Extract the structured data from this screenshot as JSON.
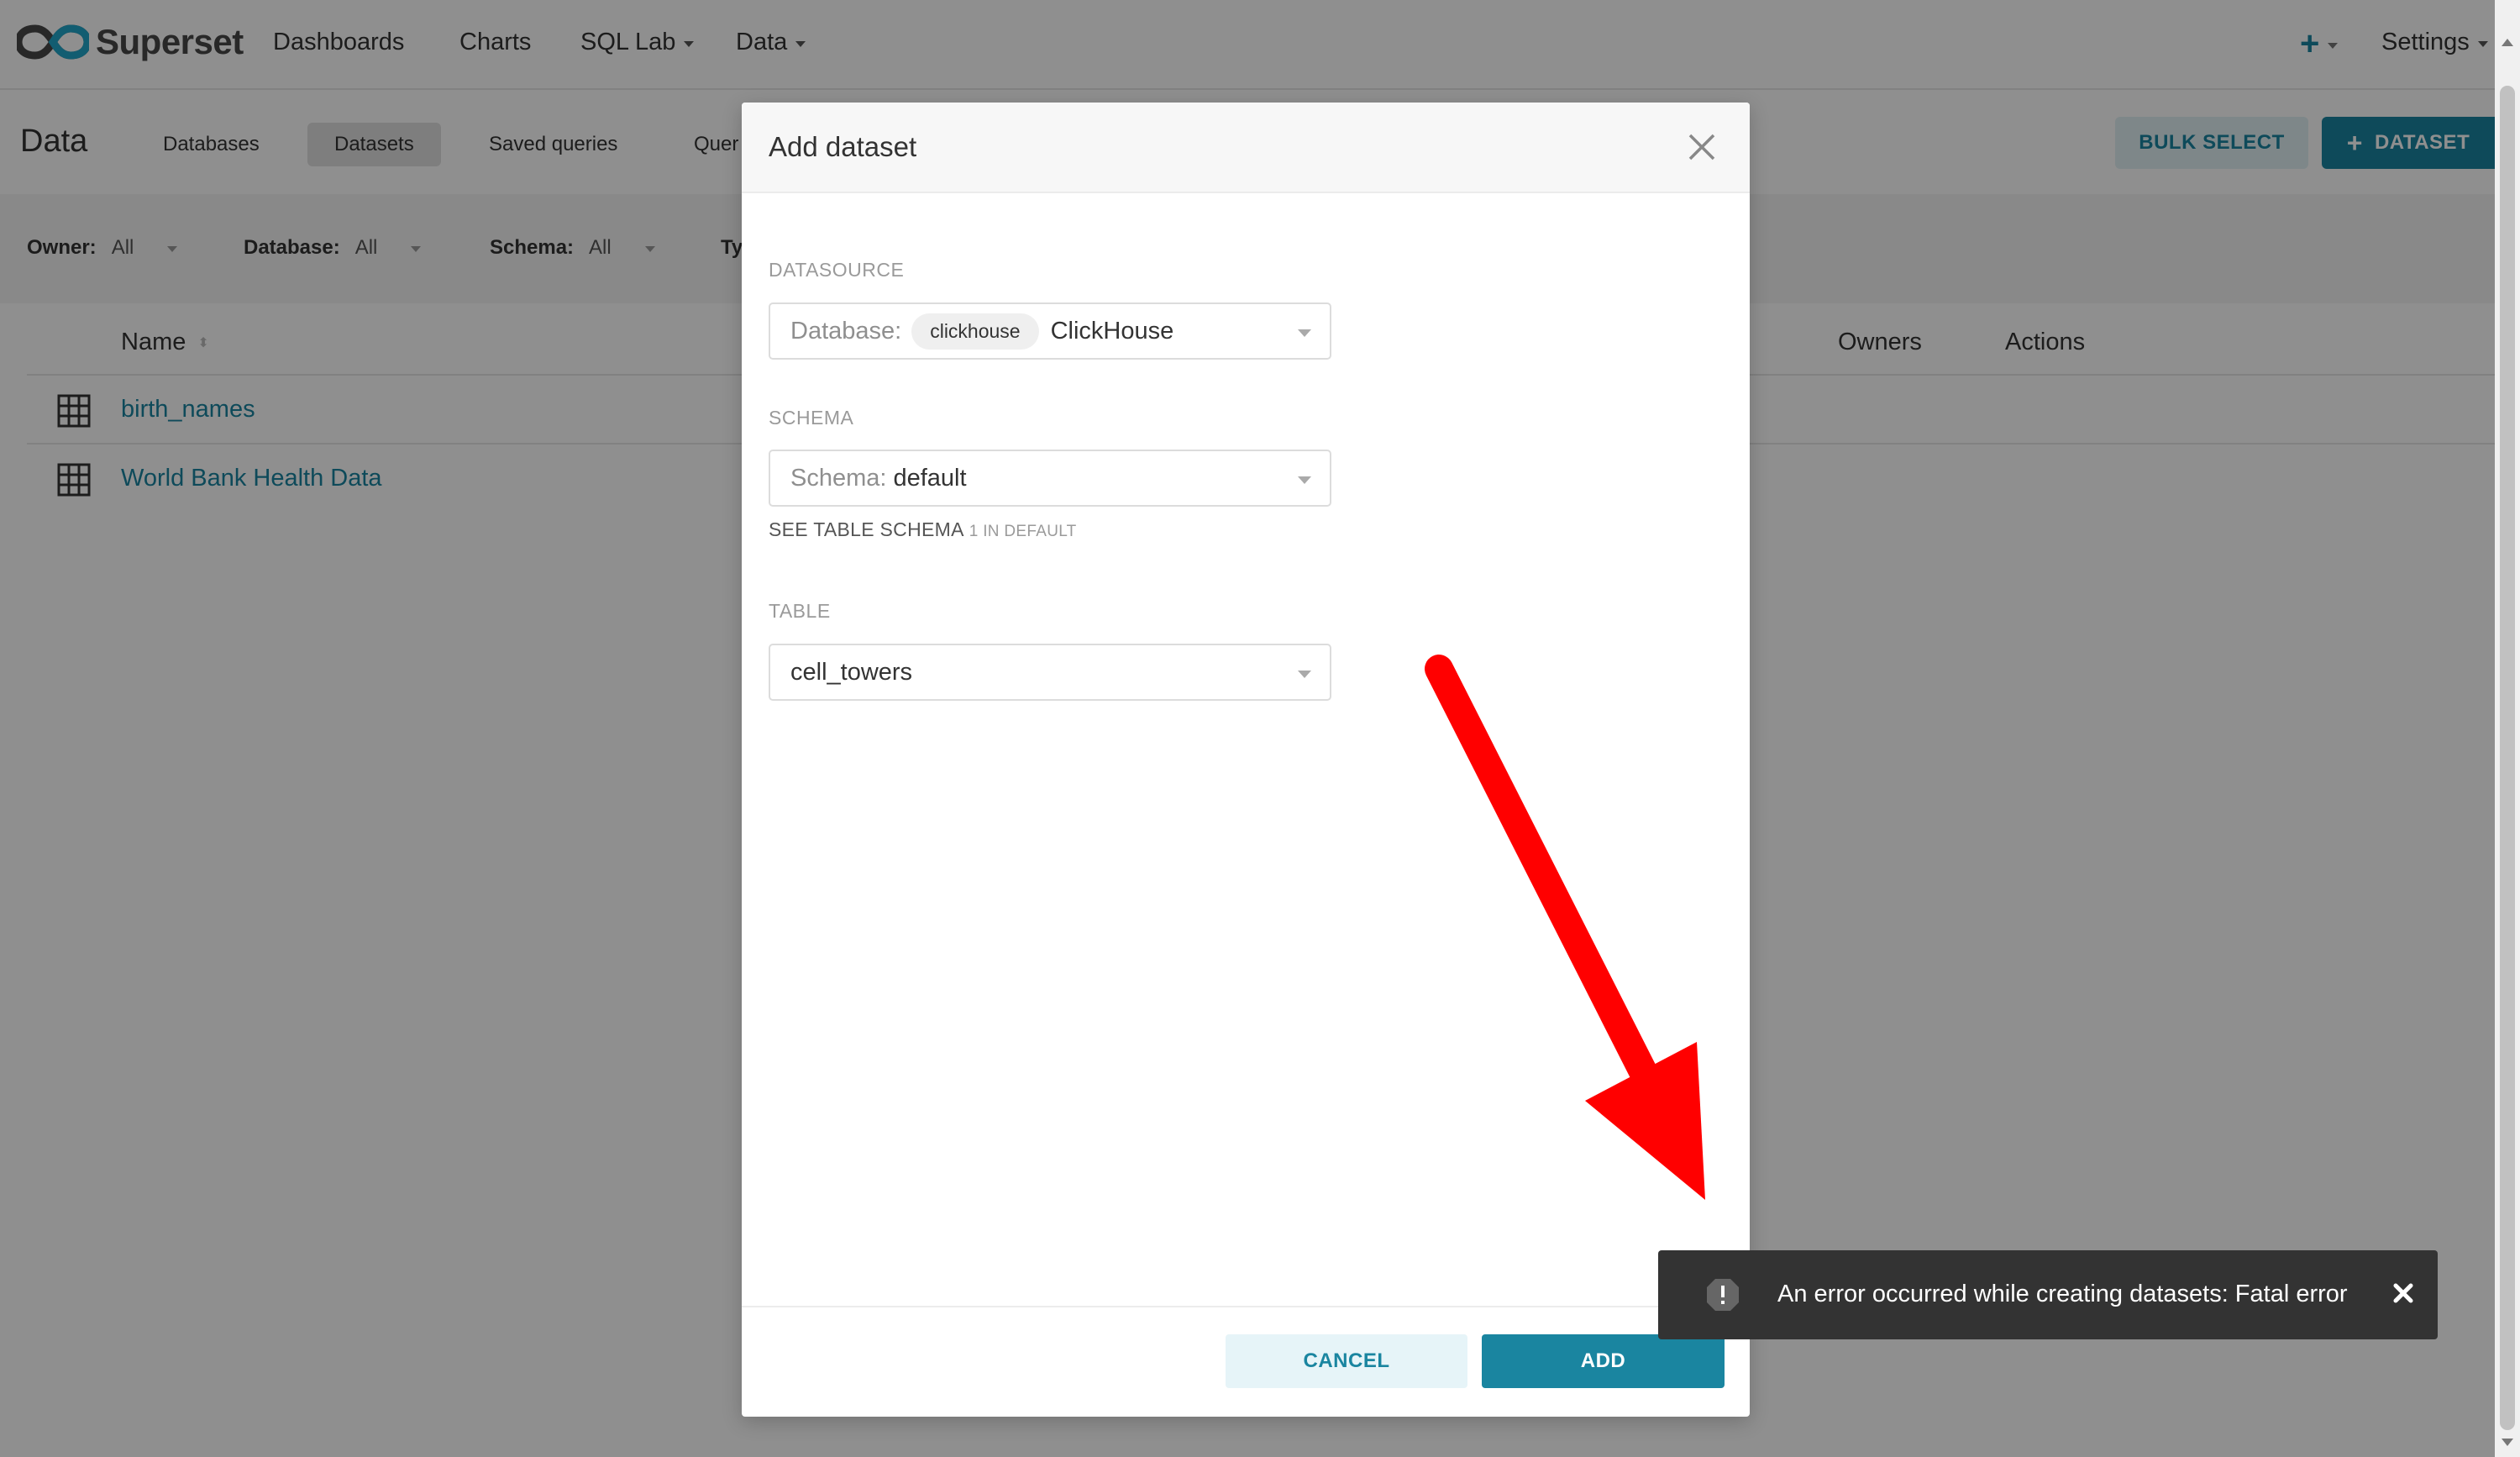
{
  "nav": {
    "brand": "Superset",
    "items": [
      {
        "label": "Dashboards",
        "dropdown": false
      },
      {
        "label": "Charts",
        "dropdown": false
      },
      {
        "label": "SQL Lab",
        "dropdown": true
      },
      {
        "label": "Data",
        "dropdown": true
      }
    ],
    "plus_label": "+",
    "settings_label": "Settings"
  },
  "subheader": {
    "title": "Data",
    "tabs": [
      {
        "label": "Databases",
        "active": false
      },
      {
        "label": "Datasets",
        "active": true
      },
      {
        "label": "Saved queries",
        "active": false
      },
      {
        "label": "Quer",
        "active": false
      }
    ],
    "bulk_select_label": "BULK SELECT",
    "add_dataset_label": "DATASET"
  },
  "filters": [
    {
      "label": "Owner:",
      "value": "All"
    },
    {
      "label": "Database:",
      "value": "All"
    },
    {
      "label": "Schema:",
      "value": "All"
    },
    {
      "label": "Ty",
      "value": ""
    }
  ],
  "table": {
    "columns": {
      "name": "Name",
      "owners": "Owners",
      "actions": "Actions"
    },
    "rows": [
      {
        "name": "birth_names"
      },
      {
        "name": "World Bank Health Data"
      }
    ]
  },
  "modal": {
    "title": "Add dataset",
    "datasource_label": "DATASOURCE",
    "database_placeholder": "Database:",
    "database_tag": "clickhouse",
    "database_value": "ClickHouse",
    "schema_label": "SCHEMA",
    "schema_placeholder": "Schema:",
    "schema_value": "default",
    "schema_hint": "SEE TABLE SCHEMA",
    "schema_hint_count": "1 IN DEFAULT",
    "table_label": "TABLE",
    "table_value": "cell_towers",
    "cancel_label": "CANCEL",
    "add_label": "ADD"
  },
  "toast": {
    "message": "An error occurred while creating datasets: Fatal error"
  },
  "colors": {
    "primary": "#1a85a0",
    "annotation_arrow": "#ff0000",
    "toast_bg": "#333333"
  }
}
